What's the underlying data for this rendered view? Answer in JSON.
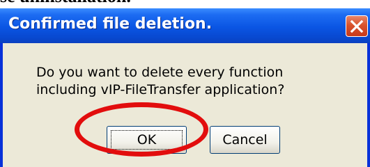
{
  "background": {
    "text": "se uninstallation."
  },
  "dialog": {
    "title": "Confirmed file deletion.",
    "close_icon": "close-icon",
    "message": "Do you want to delete every function\nincluding vIP-FileTransfer application?",
    "buttons": {
      "ok": "OK",
      "cancel": "Cancel"
    }
  },
  "colors": {
    "titlebar": "#0a55e3",
    "close_button": "#d9532c",
    "client": "#ece9d8",
    "highlight_ellipse": "#e20d0d"
  }
}
